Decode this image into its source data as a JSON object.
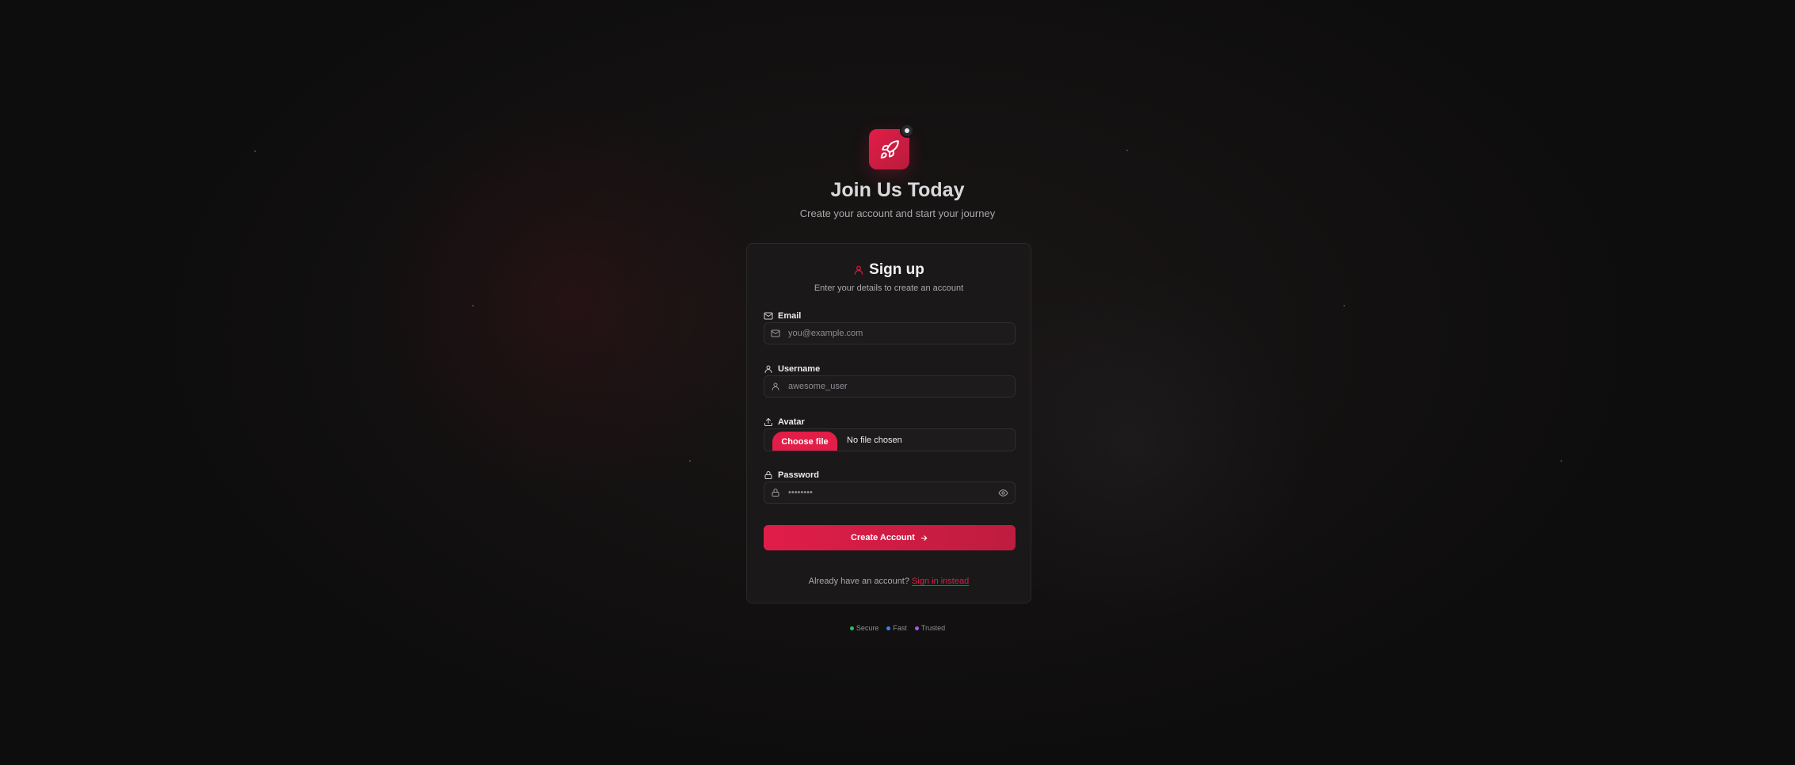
{
  "colors": {
    "accent": "#e11d48",
    "background": "#0e0d0d",
    "card": "#1a1818",
    "secure": "#22c55e",
    "fast": "#3b82f6",
    "trusted": "#a855f7"
  },
  "hero": {
    "logo_icon": "rocket-icon",
    "title": "Join Us Today",
    "subtitle": "Create your account and start your journey"
  },
  "card": {
    "title_icon": "user-icon",
    "title": "Sign up",
    "subtitle": "Enter your details to create an account"
  },
  "form": {
    "email": {
      "label": "Email",
      "icon": "mail-icon",
      "placeholder": "you@example.com",
      "value": ""
    },
    "username": {
      "label": "Username",
      "icon": "user-icon",
      "placeholder": "awesome_user",
      "value": ""
    },
    "avatar": {
      "label": "Avatar",
      "icon": "upload-icon",
      "button_label": "Choose file",
      "status": "No file chosen"
    },
    "password": {
      "label": "Password",
      "icon": "lock-icon",
      "placeholder": "••••••••",
      "toggle_icon": "eye-icon"
    },
    "submit_label": "Create Account",
    "submit_icon": "arrow-right-icon"
  },
  "footer": {
    "prompt": "Already have an account?",
    "link_label": "Sign in instead"
  },
  "badges": [
    {
      "label": "Secure",
      "color": "#22c55e"
    },
    {
      "label": "Fast",
      "color": "#3b82f6"
    },
    {
      "label": "Trusted",
      "color": "#a855f7"
    }
  ]
}
